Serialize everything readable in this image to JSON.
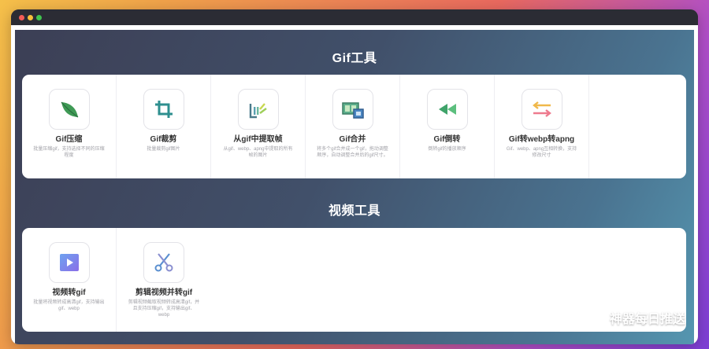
{
  "window": {
    "controls": [
      "close",
      "minimize",
      "maximize"
    ]
  },
  "sections": [
    {
      "title": "Gif工具",
      "tools": [
        {
          "name": "Gif压缩",
          "desc": "批量压缩gif，支持选择不同的压缩程度",
          "icon": "leaf-icon"
        },
        {
          "name": "Gif裁剪",
          "desc": "批量裁剪gif图片",
          "icon": "crop-icon"
        },
        {
          "name": "从gif中提取帧",
          "desc": "从gif、webp、apng中提取的所有帧的图片",
          "icon": "frames-icon"
        },
        {
          "name": "Gif合并",
          "desc": "将多个gif合并成一个gif，拖动调整顺序，自动调整合并后的gif尺寸。",
          "icon": "film-icon"
        },
        {
          "name": "Gif倒转",
          "desc": "倒转gif的播放顺序",
          "icon": "rewind-icon"
        },
        {
          "name": "Gif转webp转apng",
          "desc": "Gif、webp、apng互相转换，支持修改尺寸",
          "icon": "swap-arrows-icon"
        }
      ]
    },
    {
      "title": "视频工具",
      "tools": [
        {
          "name": "视频转gif",
          "desc": "批量将视频转成高清gif，支持输出gif、webp",
          "icon": "play-icon"
        },
        {
          "name": "剪辑视频并转gif",
          "desc": "剪辑视频截取视频转成高清gif，并且支持压缩gif，支持输出gif、webp",
          "icon": "scissors-icon"
        }
      ]
    }
  ],
  "watermark": {
    "text": "神器每日推送",
    "icon": "wechat-icon"
  },
  "colors": {
    "panel_start": "#3c3f55",
    "panel_end": "#5596b0",
    "leaf": "#3f9a55",
    "crop": "#2e8f8f",
    "rewind": "#3fa36a",
    "play": "#6f7fe8",
    "scissors": "#5a8fd0"
  }
}
